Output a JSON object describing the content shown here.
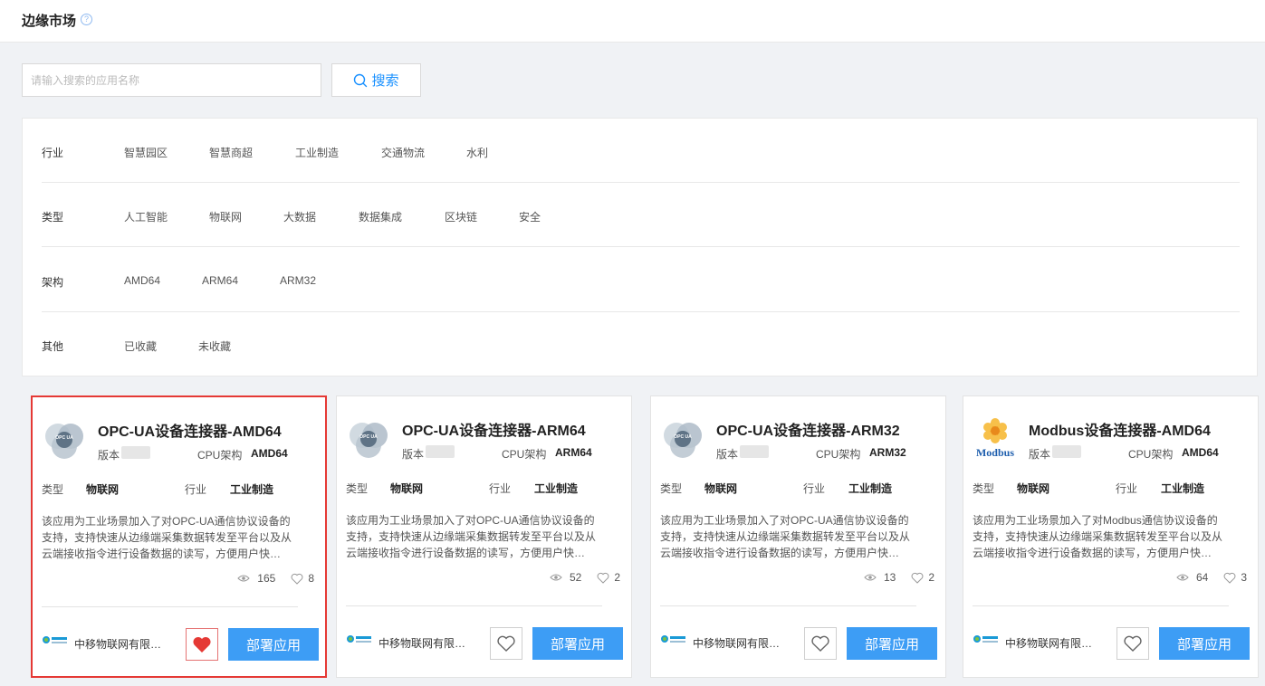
{
  "header": {
    "title": "边缘市场",
    "help_icon": "question-circle-icon"
  },
  "search": {
    "placeholder": "请输入搜索的应用名称",
    "value": "",
    "button_label": "搜索",
    "icon": "search-icon"
  },
  "filters": [
    {
      "label": "行业",
      "options": [
        "智慧园区",
        "智慧商超",
        "工业制造",
        "交通物流",
        "水利"
      ]
    },
    {
      "label": "类型",
      "options": [
        "人工智能",
        "物联网",
        "大数据",
        "数据集成",
        "区块链",
        "安全"
      ]
    },
    {
      "label": "架构",
      "options": [
        "AMD64",
        "ARM64",
        "ARM32"
      ]
    },
    {
      "label": "其他",
      "options": [
        "已收藏",
        "未收藏"
      ]
    }
  ],
  "colors": {
    "accent": "#3d9df5",
    "selected_border": "#e53935",
    "favorite": "#e53935"
  },
  "cards": [
    {
      "title": "OPC-UA设备连接器-AMD64",
      "version_label": "版本",
      "cpu_label": "CPU架构",
      "cpu_value": "AMD64",
      "type_label": "类型",
      "type_value": "物联网",
      "industry_label": "行业",
      "industry_value": "工业制造",
      "description": "该应用为工业场景加入了对OPC-UA通信协议设备的支持，支持快速从边缘端采集数据转发至平台以及从云端接收指令进行设备数据的读写，方便用户快速实现设备接入。",
      "views": "165",
      "likes": "8",
      "company": "中移物联网有限公司",
      "favorited": true,
      "deploy_label": "部署应用",
      "logo_icon": "opc-ua-logo-icon"
    },
    {
      "title": "OPC-UA设备连接器-ARM64",
      "version_label": "版本",
      "cpu_label": "CPU架构",
      "cpu_value": "ARM64",
      "type_label": "类型",
      "type_value": "物联网",
      "industry_label": "行业",
      "industry_value": "工业制造",
      "description": "该应用为工业场景加入了对OPC-UA通信协议设备的支持，支持快速从边缘端采集数据转发至平台以及从云端接收指令进行设备数据的读写，方便用户快速实现设备接入。",
      "views": "52",
      "likes": "2",
      "company": "中移物联网有限公司",
      "favorited": false,
      "deploy_label": "部署应用",
      "logo_icon": "opc-ua-logo-icon"
    },
    {
      "title": "OPC-UA设备连接器-ARM32",
      "version_label": "版本",
      "cpu_label": "CPU架构",
      "cpu_value": "ARM32",
      "type_label": "类型",
      "type_value": "物联网",
      "industry_label": "行业",
      "industry_value": "工业制造",
      "description": "该应用为工业场景加入了对OPC-UA通信协议设备的支持，支持快速从边缘端采集数据转发至平台以及从云端接收指令进行设备数据的读写，方便用户快速实现设备接入。",
      "views": "13",
      "likes": "2",
      "company": "中移物联网有限公司",
      "favorited": false,
      "deploy_label": "部署应用",
      "logo_icon": "opc-ua-logo-icon"
    },
    {
      "title": "Modbus设备连接器-AMD64",
      "version_label": "版本",
      "cpu_label": "CPU架构",
      "cpu_value": "AMD64",
      "type_label": "类型",
      "type_value": "物联网",
      "industry_label": "行业",
      "industry_value": "工业制造",
      "description": "该应用为工业场景加入了对Modbus通信协议设备的支持，支持快速从边缘端采集数据转发至平台以及从云端接收指令进行设备数据的读写，方便用户快速实现设备接入。",
      "views": "64",
      "likes": "3",
      "company": "中移物联网有限公司",
      "favorited": false,
      "deploy_label": "部署应用",
      "logo_icon": "modbus-logo-icon"
    }
  ]
}
